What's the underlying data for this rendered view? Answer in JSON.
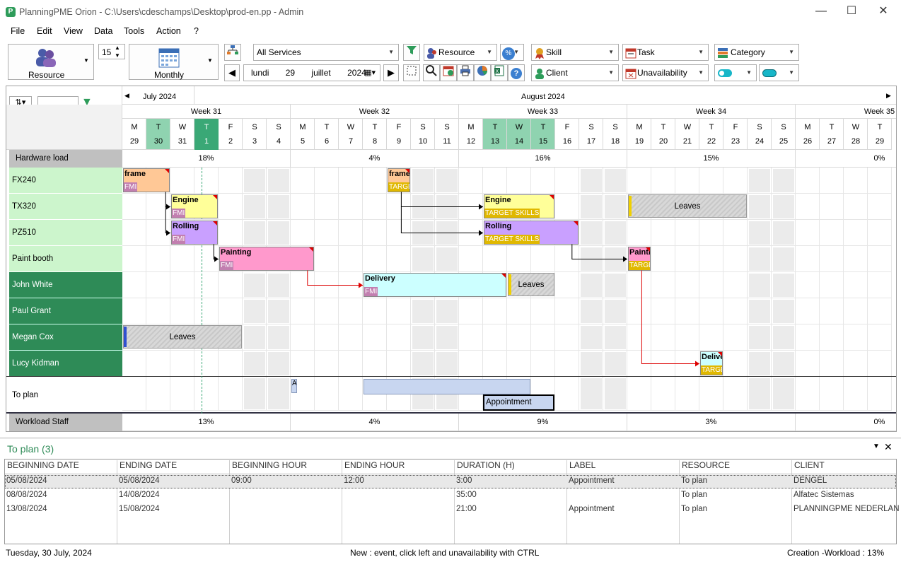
{
  "window": {
    "title": "PlanningPME Orion - C:\\Users\\cdeschamps\\Desktop\\prod-en.pp - Admin",
    "app_icon": "P"
  },
  "menu": [
    "File",
    "Edit",
    "View",
    "Data",
    "Tools",
    "Action",
    "?"
  ],
  "toolbar": {
    "view_button": "Resource",
    "period_value": "15",
    "period_button": "Monthly",
    "services": "All Services",
    "resource_filter": "Resource",
    "skill": "Skill",
    "task": "Task",
    "category": "Category",
    "client": "Client",
    "unavailability": "Unavailability",
    "date": {
      "day_name": "lundi",
      "day": "29",
      "month": "juillet",
      "year": "2024"
    }
  },
  "timeline": {
    "months": [
      "July 2024",
      "August 2024"
    ],
    "weeks": [
      "Week 31",
      "Week 32",
      "Week 33",
      "Week 34",
      "Week 35"
    ],
    "day_letters": [
      "M",
      "T",
      "W",
      "T",
      "F",
      "S",
      "S",
      "M",
      "T",
      "W",
      "T",
      "F",
      "S",
      "S",
      "M",
      "T",
      "W",
      "T",
      "F",
      "S",
      "S",
      "M",
      "T",
      "W",
      "T",
      "F",
      "S",
      "S",
      "M",
      "T",
      "W",
      "T"
    ],
    "day_numbers": [
      "29",
      "30",
      "31",
      "1",
      "2",
      "3",
      "4",
      "5",
      "6",
      "7",
      "8",
      "9",
      "10",
      "11",
      "12",
      "13",
      "14",
      "15",
      "16",
      "17",
      "18",
      "19",
      "20",
      "21",
      "22",
      "23",
      "24",
      "25",
      "26",
      "27",
      "28",
      "29"
    ],
    "hardware_load_label": "Hardware load",
    "hardware_load": [
      "18%",
      "4%",
      "16%",
      "15%",
      "0%"
    ],
    "workload_label": "Workload Staff",
    "workload": [
      "13%",
      "4%",
      "9%",
      "3%",
      "0%"
    ]
  },
  "resources": {
    "equipment": [
      "FX240",
      "TX320",
      "PZ510",
      "Paint booth"
    ],
    "staff": [
      "John White",
      "Paul Grant",
      "Megan Cox",
      "Lucy Kidman"
    ],
    "to_plan": "To plan"
  },
  "tasks": {
    "frame1": {
      "label": "frame",
      "tag": "FMI"
    },
    "frame2": {
      "label": "frame",
      "tag": "TARGE"
    },
    "engine1": {
      "label": "Engine",
      "tag": "FMI"
    },
    "engine2": {
      "label": "Engine",
      "tag": "TARGET SKILLS"
    },
    "rolling1": {
      "label": "Rolling",
      "tag": "FMI"
    },
    "rolling2": {
      "label": "Rolling",
      "tag": "TARGET SKILLS"
    },
    "painting1": {
      "label": "Painting",
      "tag": "FMI"
    },
    "painting2": {
      "label": "Painti",
      "tag": "TARGE"
    },
    "delivery1": {
      "label": "Delivery",
      "tag": "FMI"
    },
    "delivery2": {
      "label": "Delive",
      "tag": "TARGE"
    },
    "leaves": "Leaves",
    "appointment": "Appointment",
    "a_small": "A"
  },
  "bottom": {
    "title": "To plan (3)",
    "columns": [
      "BEGINNING DATE",
      "ENDING DATE",
      "BEGINNING HOUR",
      "ENDING HOUR",
      "DURATION (H)",
      "LABEL",
      "RESOURCE",
      "CLIENT"
    ],
    "rows": [
      [
        "05/08/2024",
        "05/08/2024",
        "09:00",
        "12:00",
        "3:00",
        "Appointment",
        "To plan",
        "DENGEL"
      ],
      [
        "08/08/2024",
        "14/08/2024",
        "",
        "",
        "35:00",
        "",
        "To plan",
        "Alfatec Sistemas"
      ],
      [
        "13/08/2024",
        "15/08/2024",
        "",
        "",
        "21:00",
        "Appointment",
        "To plan",
        "PLANNINGPME NEDERLAN"
      ]
    ]
  },
  "status": {
    "left": "Tuesday, 30 July, 2024",
    "center": "New : event, click left and unavailability with CTRL",
    "right": "Creation -Workload : 13%"
  },
  "colors": {
    "green_header": "#2e8b57",
    "light_green": "#ccf5cc",
    "accent": "#2e9c5a"
  }
}
